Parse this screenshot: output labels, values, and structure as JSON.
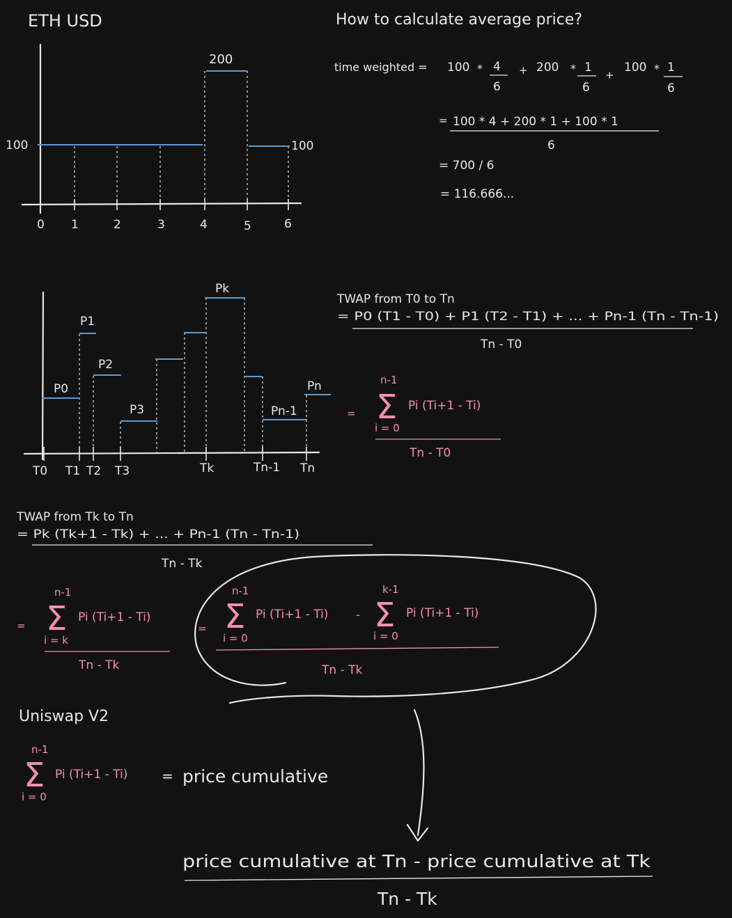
{
  "chart1": {
    "title": "ETH USD",
    "y_label_left": "100",
    "y_label_right": "100",
    "top_value": "200",
    "x_ticks": [
      "0",
      "1",
      "2",
      "3",
      "4",
      "5",
      "6"
    ]
  },
  "avg": {
    "question": "How to calculate average price?",
    "tw_label": "time weighted =",
    "t1_val": "100",
    "t1_num": "4",
    "t1_den": "6",
    "t2_val": "200",
    "t2_num": "1",
    "t2_den": "6",
    "t3_val": "100",
    "t3_num": "1",
    "t3_den": "6",
    "op_mult": "*",
    "op_plus": "+",
    "eq": "=",
    "line2_num": "100 * 4 + 200 * 1 + 100 * 1",
    "line2_den": "6",
    "line3": "= 700 / 6",
    "line4": "= 116.666..."
  },
  "chart2": {
    "labels": [
      "P0",
      "P1",
      "P2",
      "P3",
      "Pk",
      "Pn-1",
      "Pn"
    ],
    "x_ticks": [
      "T0",
      "T1",
      "T2",
      "T3",
      "Tk",
      "Tn-1",
      "Tn"
    ]
  },
  "twap_full": {
    "title": "TWAP from T0 to Tn",
    "numerator": "= P0 (T1 - T0) + P1 (T2 - T1) + ... + Pn-1 (Tn - Tn-1)",
    "denominator": "Tn - T0",
    "eq": "=",
    "sum_top": "n-1",
    "sum_bottom": "i = 0",
    "sum_body": "Pi (Ti+1 - Ti)",
    "den2": "Tn - T0"
  },
  "twap_k": {
    "title": "TWAP from Tk to Tn",
    "numerator": "= Pk (Tk+1 - Tk) + ... + Pn-1 (Tn - Tn-1)",
    "denominator": "Tn - Tk",
    "eq": "=",
    "sum_top": "n-1",
    "sum_bottom": "i = k",
    "sum_body": "Pi (Ti+1 - Ti)",
    "den2": "Tn - Tk",
    "eq2": "=",
    "s1_top": "n-1",
    "s1_bottom": "i = 0",
    "s1_body": "Pi (Ti+1 - Ti)",
    "minus": "-",
    "s2_top": "k-1",
    "s2_bottom": "i = 0",
    "s2_body": "Pi (Ti+1 - Ti)",
    "den3": "Tn - Tk"
  },
  "uniswap": {
    "title": "Uniswap V2",
    "sum_top": "n-1",
    "sum_bottom": "i = 0",
    "sum_body": "Pi (Ti+1 - Ti)",
    "eq": "=",
    "rhs": "price cumulative"
  },
  "final": {
    "numerator": "price cumulative at Tn - price cumulative at Tk",
    "denominator": "Tn - Tk"
  },
  "sigma": "Σ",
  "colors": {
    "background": "#121212",
    "text": "#e8e8e8",
    "pink": "#f28fb4",
    "blue": "#5b9bd5"
  }
}
